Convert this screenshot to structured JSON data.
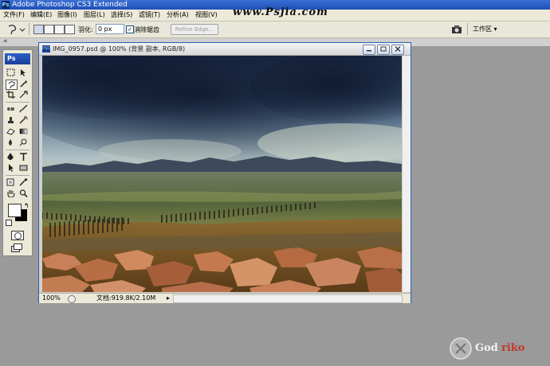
{
  "app": {
    "title": "Adobe Photoshop CS3 Extended",
    "icon_text": "Ps"
  },
  "watermark_top": "www.Psjia.com",
  "menu": [
    {
      "label": "文件(F)"
    },
    {
      "label": "编辑(E)"
    },
    {
      "label": "图像(I)"
    },
    {
      "label": "图层(L)"
    },
    {
      "label": "选择(S)"
    },
    {
      "label": "滤镜(T)"
    },
    {
      "label": "分析(A)"
    },
    {
      "label": "视图(V)"
    }
  ],
  "options": {
    "feather_label": "羽化:",
    "feather_value": "0 px",
    "antialias_label": "消除锯齿",
    "antialias_checked": "✓",
    "refine_edge": "Refine Edge...",
    "workspace": "工作区 ▾"
  },
  "panel_strip": {
    "collapse_glyph": "«"
  },
  "toolbox": {
    "logo": "Ps"
  },
  "document": {
    "title": "IMG_0957.psd @ 100% (背景 副本, RGB/8)",
    "icon_text": "PSD",
    "zoom": "100%",
    "doc_size": "文档:919.8K/2.10M",
    "status_arrow": "▸"
  },
  "colors": {
    "title_bar": "#2152c0",
    "workspace_bg": "#9a9a9a",
    "chrome": "#ece9d8"
  },
  "bottom_logo": {
    "text": "God",
    "accent": "riko"
  }
}
